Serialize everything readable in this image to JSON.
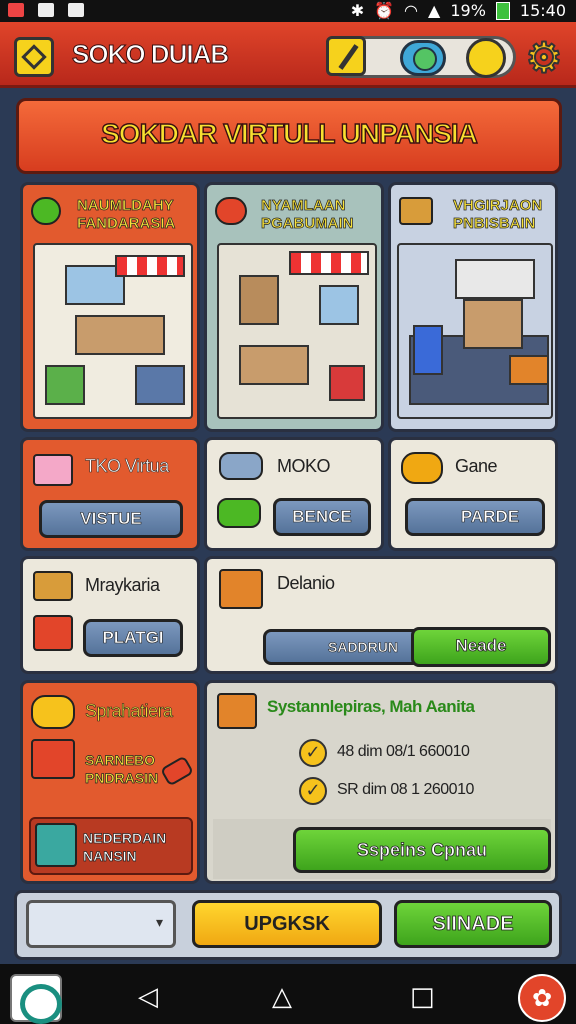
{
  "status_bar": {
    "battery": "19%",
    "time": "15:40"
  },
  "header": {
    "title": "SOKO DUIAB"
  },
  "banner": {
    "title": "SOKDAR VIRTULL UNPANSIA"
  },
  "cards": [
    {
      "title": "NAUMLDAHY FANDARASIA",
      "color": "#e25a2e"
    },
    {
      "title": "NYAMLAAN PGABUMAIN",
      "color": "#a8c2bc"
    },
    {
      "title": "VHGIRJAON PNBISBAIN",
      "color": "#c8d2e2"
    }
  ],
  "row2": [
    {
      "label": "TKO Virtua",
      "button": "VISTUE"
    },
    {
      "label": "MOKO",
      "button": "BENCE"
    },
    {
      "label": "Gane",
      "button": "PARDE"
    }
  ],
  "row3": {
    "left_label": "Mraykaria",
    "left_button": "PLATGI",
    "right_title": "Delanio",
    "chip_label": "SADDRUN",
    "green_button": "Neade"
  },
  "row4": {
    "left_title": "Sprahatiera",
    "left_sub": "SARNEBO PNDRASIN",
    "left_card": "NEDERDAIN NANSIN",
    "right_title": "Systannlepiras, Mah Aanita",
    "checks": [
      "48 dim 08/1 660010",
      "SR dim 08 1 260010"
    ],
    "green_button": "Sspeins Cpnau"
  },
  "footer": {
    "yellow_button": "UPGKSK",
    "green_button": "SIINADE"
  },
  "colors": {
    "header": "#d2361f",
    "accent_yellow": "#f6d21c",
    "accent_green": "#4cb824"
  }
}
